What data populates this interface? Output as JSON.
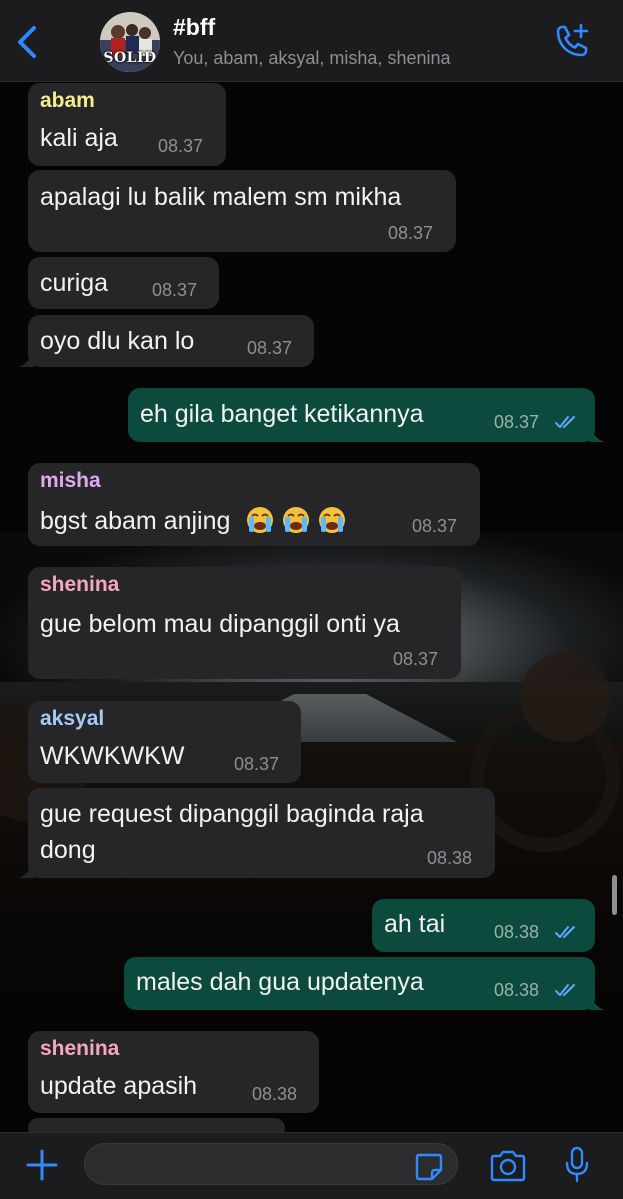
{
  "header": {
    "title": "#bff",
    "subtitle": "You, abam, aksyal, misha, shenina",
    "avatar_text": "SOLID",
    "back_icon": "chevron-left-icon",
    "call_icon": "phone-plus-icon"
  },
  "colors": {
    "accent": "#2f89ff",
    "incoming_bubble": "#262628",
    "outgoing_bubble": "#0b4a3d",
    "abam": "#f7ed8d",
    "misha": "#e0a8ee",
    "shenina": "#f4a6c2",
    "aksyal": "#a9c8f7",
    "read_ticks": "#5ba8ff"
  },
  "messages": [
    {
      "sender": "abam",
      "text": "kali aja",
      "time": "08.37"
    },
    {
      "text": "apalagi lu balik malem sm mikha",
      "time": "08.37"
    },
    {
      "text": "curiga",
      "time": "08.37"
    },
    {
      "text": "oyo dlu kan lo",
      "time": "08.37"
    },
    {
      "text": "eh gila banget ketikannya",
      "time": "08.37",
      "outgoing": true,
      "status": "read"
    },
    {
      "sender": "misha",
      "text": "bgst abam anjing",
      "emoji": [
        "loudly-crying-face",
        "loudly-crying-face",
        "loudly-crying-face"
      ],
      "time": "08.37"
    },
    {
      "sender": "shenina",
      "text": "gue belom mau dipanggil onti ya",
      "time": "08.37"
    },
    {
      "sender": "aksyal",
      "text": "WKWKWKW",
      "time": "08.37"
    },
    {
      "text_line1": "gue request dipanggil baginda raja",
      "text_line2": "dong",
      "time": "08.38"
    },
    {
      "text": "ah tai",
      "time": "08.38",
      "outgoing": true,
      "status": "read"
    },
    {
      "text": "males dah gua updatenya",
      "time": "08.38",
      "outgoing": true,
      "status": "read"
    },
    {
      "sender": "shenina",
      "text": "update apasih",
      "time": "08.38"
    }
  ],
  "input": {
    "placeholder": "",
    "plus_icon": "plus-icon",
    "sticker_icon": "sticker-icon",
    "camera_icon": "camera-icon",
    "mic_icon": "microphone-icon"
  }
}
